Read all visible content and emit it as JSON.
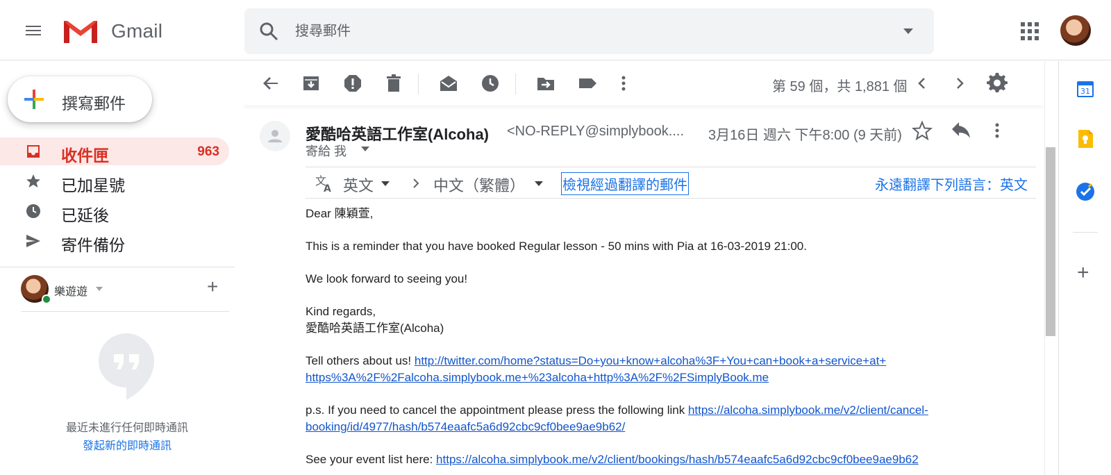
{
  "header": {
    "app_name": "Gmail",
    "search_placeholder": "搜尋郵件"
  },
  "sidebar": {
    "compose_label": "撰寫郵件",
    "items": [
      {
        "label": "收件匣",
        "count": "963",
        "icon": "inbox-icon",
        "active": true
      },
      {
        "label": "已加星號",
        "count": "",
        "icon": "star-icon",
        "active": false
      },
      {
        "label": "已延後",
        "count": "",
        "icon": "clock-icon",
        "active": false
      },
      {
        "label": "寄件備份",
        "count": "",
        "icon": "send-icon",
        "active": false
      }
    ]
  },
  "chat": {
    "user_name": "樂遊遊",
    "empty_text": "最近未進行任何即時通訊",
    "start_link": "發起新的即時通訊"
  },
  "toolbar": {
    "pager_text": "第 59 個，共 1,881 個",
    "icons": [
      "back-arrow-icon",
      "archive-icon",
      "report-spam-icon",
      "delete-icon",
      "mark-unread-icon",
      "snooze-icon",
      "move-to-icon",
      "label-icon",
      "more-icon"
    ]
  },
  "email": {
    "sender_name": "愛酷哈英語工作室(Alcoha)",
    "sender_email": "<NO-REPLY@simplybook....",
    "date": "3月16日 週六 下午8:00 (9 天前)",
    "to_line": "寄給 我",
    "translate": {
      "from_lang": "英文",
      "to_lang": "中文（繁體）",
      "view_link": "檢視經過翻譯的郵件",
      "always_link": "永遠翻譯下列語言：英文"
    },
    "body": {
      "greeting": "Dear 陳穎萱,",
      "line1": "This is a reminder that you have booked Regular lesson - 50 mins with Pia at 16-03-2019 21:00.",
      "line2": "We look forward to seeing you!",
      "regards": "Kind regards,",
      "signature": "愛酷哈英語工作室(Alcoha)",
      "tell_prefix": "Tell others about us! ",
      "tell_link_a": "http://twitter.com/home?status=Do+you+know+alcoha%3F+You+can+book+a+service+at+",
      "tell_link_b": "https%3A%2F%2Falcoha.simplybook.me+%23alcoha+http%3A%2F%2FSimplyBook.me",
      "ps_prefix": "p.s. If you need to cancel the appointment please press the following link ",
      "ps_link_a": "https://alcoha.simplybook.me/v2/client/cancel-",
      "ps_link_b": "booking/id/4977/hash/b574eaafc5a6d92cbc9cf0bee9ae9b62/",
      "events_prefix": "See your event list here: ",
      "events_link": "https://alcoha.simplybook.me/v2/client/bookings/hash/b574eaafc5a6d92cbc9cf0bee9ae9b62"
    }
  },
  "right_panel": {
    "calendar_day": "31",
    "icons": [
      "calendar-icon",
      "keep-icon",
      "tasks-icon",
      "add-addon-icon"
    ]
  },
  "colors": {
    "accent_red": "#d93025",
    "link_blue": "#1a73e8",
    "active_bg": "#fce8e6"
  }
}
